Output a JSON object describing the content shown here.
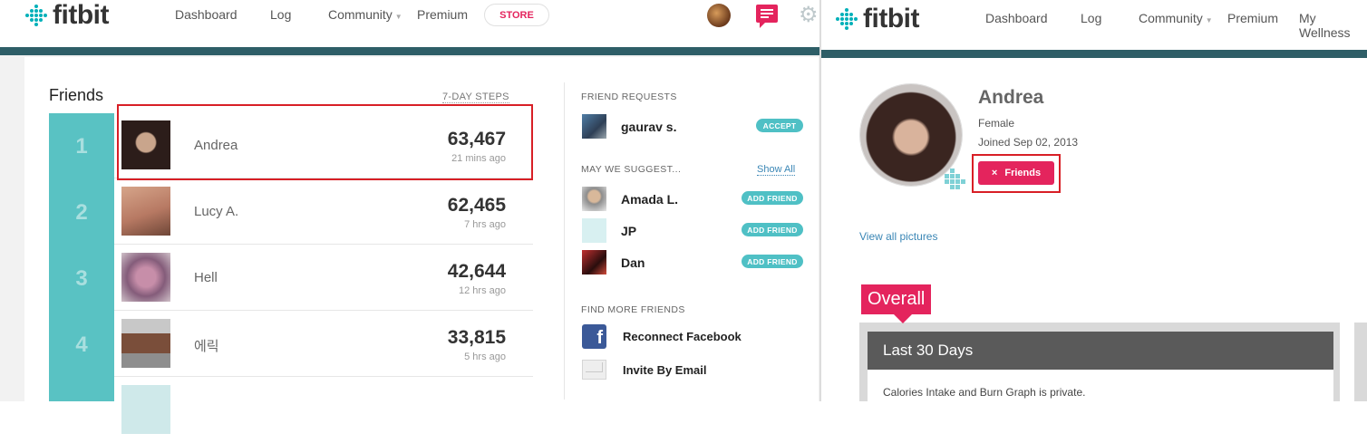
{
  "left": {
    "logo": "fitbit",
    "nav": [
      "Dashboard",
      "Log",
      "Community",
      "Premium"
    ],
    "store_label": "STORE",
    "friends_title": "Friends",
    "steps_header": "7-DAY STEPS",
    "friends": [
      {
        "rank": "1",
        "name": "Andrea",
        "steps": "63,467",
        "time": "21 mins ago"
      },
      {
        "rank": "2",
        "name": "Lucy A.",
        "steps": "62,465",
        "time": "7 hrs ago"
      },
      {
        "rank": "3",
        "name": "Hell",
        "steps": "42,644",
        "time": "12 hrs ago"
      },
      {
        "rank": "4",
        "name": "에릭",
        "steps": "33,815",
        "time": "5 hrs ago"
      }
    ],
    "requests_header": "FRIEND REQUESTS",
    "request": {
      "name": "gaurav s.",
      "action": "ACCEPT"
    },
    "suggest_header": "MAY WE SUGGEST...",
    "show_all": "Show All",
    "suggestions": [
      {
        "name": "Amada L.",
        "action": "ADD FRIEND"
      },
      {
        "name": "JP",
        "action": "ADD FRIEND"
      },
      {
        "name": "Dan",
        "action": "ADD FRIEND"
      }
    ],
    "find_header": "FIND MORE FRIENDS",
    "facebook_label": "Reconnect Facebook",
    "email_label": "Invite By Email",
    "facebook_glyph": "f"
  },
  "right": {
    "logo": "fitbit",
    "nav": [
      "Dashboard",
      "Log",
      "Community",
      "Premium",
      "My Wellness"
    ],
    "profile": {
      "name": "Andrea",
      "gender": "Female",
      "joined": "Joined Sep 02, 2013",
      "friends_button": "Friends",
      "remove_glyph": "×"
    },
    "view_pictures": "View all pictures",
    "overall_label": "Overall",
    "period_title": "Last 30 Days",
    "private_note": "Calories Intake and Burn Graph is private."
  },
  "colors": {
    "accent": "#e4245d",
    "teal": "#59c2c3",
    "nav_strip": "#2e5e67",
    "highlight": "#d81f26"
  }
}
